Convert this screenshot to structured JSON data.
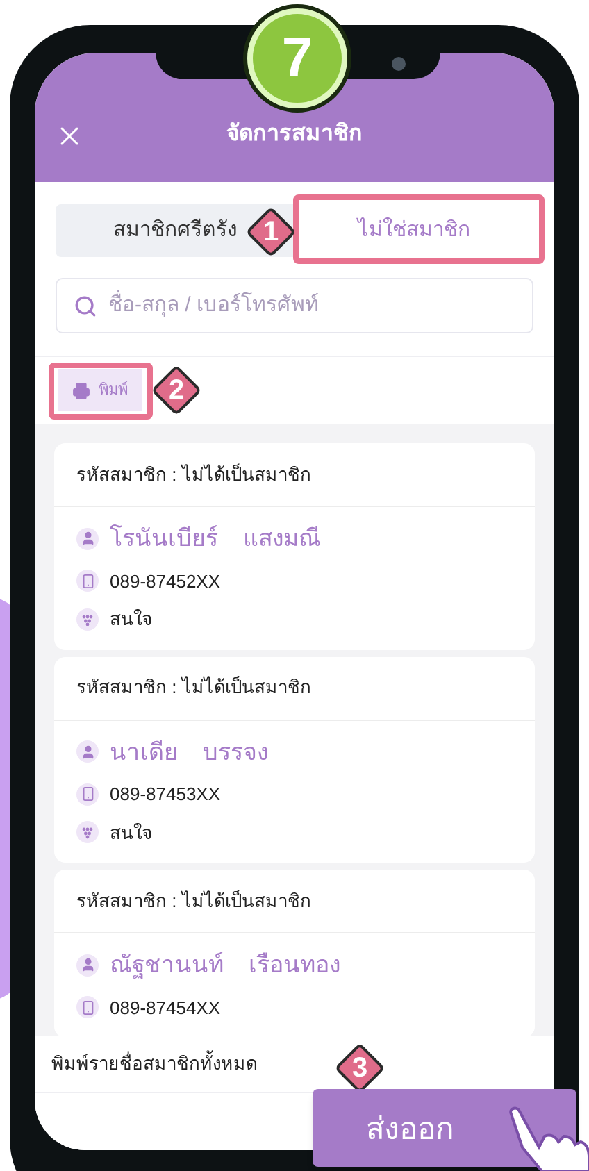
{
  "step_badge": "7",
  "header": {
    "title": "จัดการสมาชิก"
  },
  "tabs": [
    {
      "label": "สมาชิกศรีตรัง",
      "selected": false
    },
    {
      "label": "ไม่ใช่สมาชิก",
      "selected": true
    }
  ],
  "search": {
    "placeholder": "ชื่อ-สกุล / เบอร์โทรศัพท์"
  },
  "print_button": {
    "label": "พิมพ์"
  },
  "members": [
    {
      "code_label": "รหัสสมาชิก : ไม่ได้เป็นสมาชิก",
      "first_name": "โรนันเบียร์",
      "last_name": "แสงมณี",
      "phone": "089-87452XX",
      "interest": "สนใจ"
    },
    {
      "code_label": "รหัสสมาชิก : ไม่ได้เป็นสมาชิก",
      "first_name": "นาเดีย",
      "last_name": "บรรจง",
      "phone": "089-87453XX",
      "interest": "สนใจ"
    },
    {
      "code_label": "รหัสสมาชิก : ไม่ได้เป็นสมาชิก",
      "first_name": "ณัฐชานนท์",
      "last_name": "เรือนทอง",
      "phone": "089-87454XX"
    }
  ],
  "bottom_sheet": {
    "label": "พิมพ์รายชื่อสมาชิกทั้งหมด",
    "export_button": "ส่งออก"
  },
  "callouts": [
    {
      "number": "1"
    },
    {
      "number": "2"
    },
    {
      "number": "3"
    }
  ]
}
